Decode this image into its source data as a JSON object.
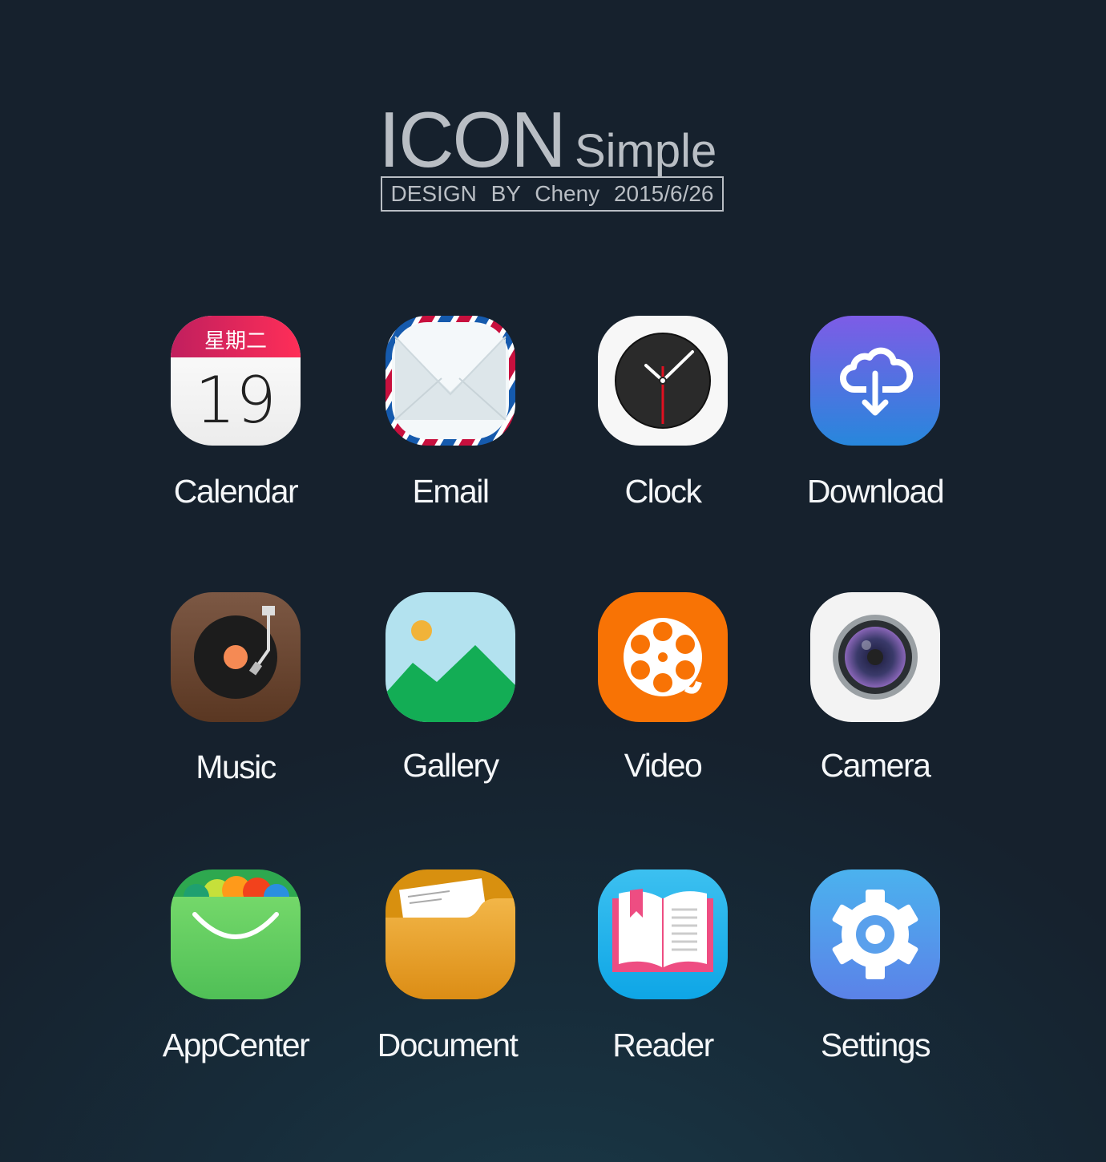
{
  "header": {
    "title": "ICON",
    "subtitle": "Simple",
    "credit": "DESIGN BY Cheny 2015/6/26"
  },
  "calendar": {
    "weekday": "星期二",
    "day": "19"
  },
  "icons": [
    {
      "label": "Calendar",
      "icon": "calendar-icon"
    },
    {
      "label": "Email",
      "icon": "envelope-icon"
    },
    {
      "label": "Clock",
      "icon": "clock-icon"
    },
    {
      "label": "Download",
      "icon": "cloud-download-icon"
    },
    {
      "label": "Music",
      "icon": "turntable-icon"
    },
    {
      "label": "Gallery",
      "icon": "landscape-icon"
    },
    {
      "label": "Video",
      "icon": "film-reel-icon"
    },
    {
      "label": "Camera",
      "icon": "camera-lens-icon"
    },
    {
      "label": "AppCenter",
      "icon": "shopping-bag-icon"
    },
    {
      "label": "Document",
      "icon": "folder-icon"
    },
    {
      "label": "Reader",
      "icon": "open-book-icon"
    },
    {
      "label": "Settings",
      "icon": "gear-icon"
    }
  ]
}
